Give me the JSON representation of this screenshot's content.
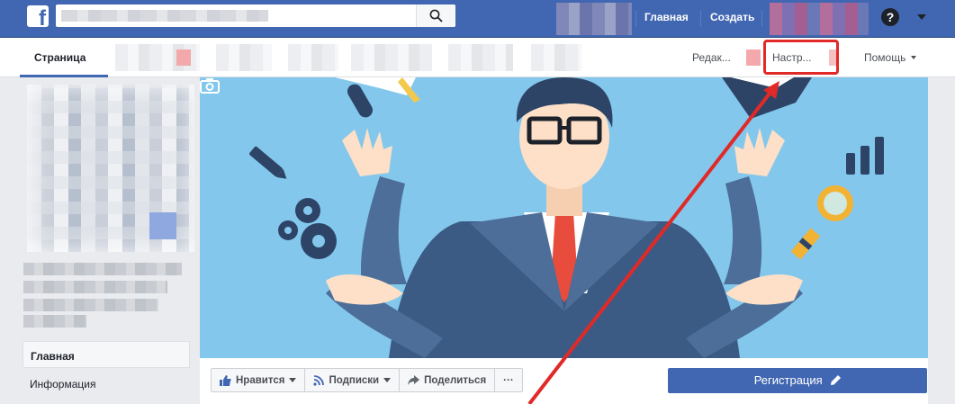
{
  "topbar": {
    "logo": "f",
    "home_label": "Главная",
    "create_label": "Создать",
    "help_label": "?",
    "colors": {
      "bar": "#4267b2",
      "button_blue": "#4267b2",
      "highlight_red": "#e02a27"
    }
  },
  "pagebar": {
    "tab_label": "Страница",
    "edit_label": "Редак...",
    "settings_label": "Настр...",
    "help_label": "Помощь"
  },
  "sidebar": {
    "items": [
      {
        "label": "Главная"
      },
      {
        "label": "Информация"
      }
    ]
  },
  "actions": {
    "like_label": "Нравится",
    "follow_label": "Подписки",
    "share_label": "Поделиться",
    "more_label": "···",
    "register_label": "Регистрация"
  },
  "icons": [
    "facebook-logo-icon",
    "search-icon",
    "question-icon",
    "chevron-down-icon",
    "camera-icon",
    "thumbs-up-icon",
    "rss-icon",
    "share-arrow-icon",
    "pencil-icon"
  ]
}
